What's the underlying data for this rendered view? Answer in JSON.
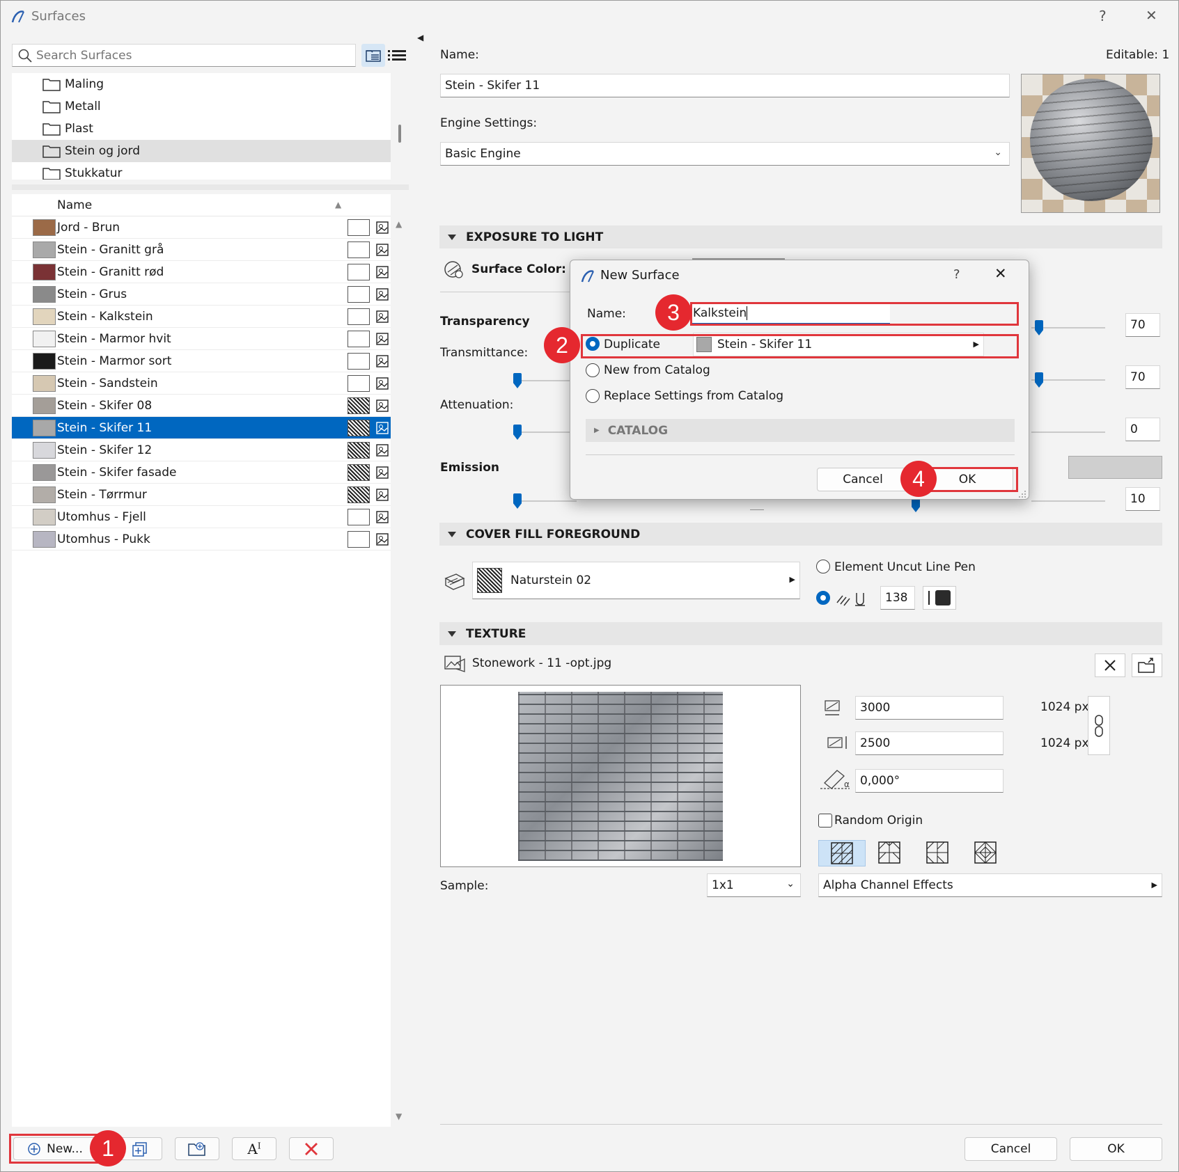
{
  "window": {
    "title": "Surfaces",
    "help": "?",
    "close": "✕"
  },
  "left": {
    "search_placeholder": "Search Surfaces",
    "folders": [
      "Maling",
      "Metall",
      "Plast",
      "Stein og jord",
      "Stukkatur"
    ],
    "list_header": "Name",
    "rows": [
      {
        "name": "Jord - Brun",
        "color": "#9b6a47",
        "pattern": false
      },
      {
        "name": "Stein - Granitt grå",
        "color": "#a9a9a9",
        "pattern": false
      },
      {
        "name": "Stein - Granitt rød",
        "color": "#7a3235",
        "pattern": false
      },
      {
        "name": "Stein - Grus",
        "color": "#8a8a8a",
        "pattern": false
      },
      {
        "name": "Stein - Kalkstein",
        "color": "#e2d5bd",
        "pattern": false
      },
      {
        "name": "Stein - Marmor hvit",
        "color": "#f1f1f1",
        "pattern": false
      },
      {
        "name": "Stein - Marmor sort",
        "color": "#1b1b1b",
        "pattern": false
      },
      {
        "name": "Stein - Sandstein",
        "color": "#d6c8b2",
        "pattern": false
      },
      {
        "name": "Stein - Skifer 08",
        "color": "#a49e98",
        "pattern": true
      },
      {
        "name": "Stein - Skifer 11",
        "color": "#a8a8a8",
        "pattern": true
      },
      {
        "name": "Stein - Skifer 12",
        "color": "#d8d8dc",
        "pattern": true
      },
      {
        "name": "Stein - Skifer fasade",
        "color": "#9a9898",
        "pattern": true
      },
      {
        "name": "Stein - Tørrmur",
        "color": "#b2ada8",
        "pattern": true
      },
      {
        "name": "Utomhus - Fjell",
        "color": "#d2cdc5",
        "pattern": false
      },
      {
        "name": "Utomhus - Pukk",
        "color": "#b7b6c2",
        "pattern": false
      }
    ],
    "new_button": "New..."
  },
  "right": {
    "name_label": "Name:",
    "editable": "Editable: 1",
    "name_value": "Stein - Skifer 11",
    "engine_label": "Engine Settings:",
    "engine_value": "Basic Engine",
    "exposure_title": "EXPOSURE TO LIGHT",
    "surface_color_label": "Surface Color:",
    "transparency_label": "Transparency",
    "transmittance_label": "Transmittance:",
    "attenuation_label": "Attenuation:",
    "emission_label": "Emission",
    "values": {
      "v1": "70",
      "v2": "70",
      "v3": "0",
      "v4": "10"
    },
    "cover_title": "COVER FILL FOREGROUND",
    "cover_fill": "Naturstein 02",
    "uncut_pen": "Element Uncut Line Pen",
    "pen_value": "138",
    "texture_title": "TEXTURE",
    "texture_file": "Stonework - 11 -opt.jpg",
    "width_value": "3000",
    "height_value": "2500",
    "angle_value": "0,000°",
    "px1": "1024 px",
    "px2": "1024 px",
    "random_origin": "Random Origin",
    "sample_label": "Sample:",
    "sample_value": "1x1",
    "alpha_effects": "Alpha Channel Effects",
    "cancel": "Cancel",
    "ok": "OK"
  },
  "dialog": {
    "title": "New Surface",
    "help": "?",
    "name_label": "Name:",
    "name_value": "Kalkstein",
    "duplicate": "Duplicate",
    "duplicate_source": "Stein - Skifer 11",
    "new_from_catalog": "New from Catalog",
    "replace_settings": "Replace Settings from Catalog",
    "catalog": "CATALOG",
    "cancel": "Cancel",
    "ok": "OK"
  },
  "badges": [
    "1",
    "2",
    "3",
    "4"
  ]
}
